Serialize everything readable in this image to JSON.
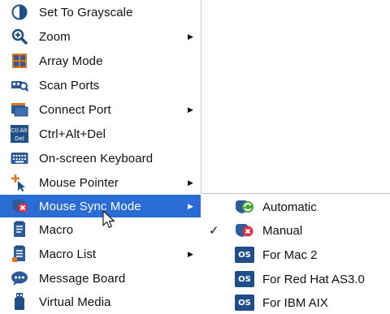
{
  "menu": {
    "items": [
      {
        "label": "Set To Grayscale",
        "icon": "grayscale-icon",
        "has_submenu": false
      },
      {
        "label": "Zoom",
        "icon": "zoom-icon",
        "has_submenu": true
      },
      {
        "label": "Array Mode",
        "icon": "array-mode-icon",
        "has_submenu": false
      },
      {
        "label": "Scan Ports",
        "icon": "scan-ports-icon",
        "has_submenu": false
      },
      {
        "label": "Connect Port",
        "icon": "connect-port-icon",
        "has_submenu": true
      },
      {
        "label": "Ctrl+Alt+Del",
        "icon": "ctrl-alt-del-icon",
        "has_submenu": false
      },
      {
        "label": "On-screen Keyboard",
        "icon": "keyboard-icon",
        "has_submenu": false
      },
      {
        "label": "Mouse Pointer",
        "icon": "mouse-pointer-icon",
        "has_submenu": true
      },
      {
        "label": "Mouse Sync Mode",
        "icon": "mouse-sync-icon",
        "has_submenu": true,
        "active": true
      },
      {
        "label": "Macro",
        "icon": "macro-icon",
        "has_submenu": false
      },
      {
        "label": "Macro List",
        "icon": "macro-list-icon",
        "has_submenu": true
      },
      {
        "label": "Message Board",
        "icon": "message-board-icon",
        "has_submenu": false
      },
      {
        "label": "Virtual Media",
        "icon": "virtual-media-icon",
        "has_submenu": false
      }
    ]
  },
  "submenu": {
    "items": [
      {
        "label": "Automatic",
        "icon": "automatic-sync-icon",
        "checked": false
      },
      {
        "label": "Manual",
        "icon": "manual-sync-icon",
        "checked": true
      },
      {
        "label": "For Mac 2",
        "icon": "os-icon",
        "badge": "OS",
        "checked": false
      },
      {
        "label": "For Red Hat AS3.0",
        "icon": "os-icon",
        "badge": "OS",
        "checked": false
      },
      {
        "label": "For IBM AIX",
        "icon": "os-icon",
        "badge": "OS",
        "checked": false
      }
    ]
  },
  "glyphs": {
    "arrow": "▶",
    "check": "✓"
  },
  "ctrl_icon": {
    "top_left": "Ctl",
    "top_right": "Alt",
    "bottom": "Del"
  },
  "colors": {
    "highlight": "#2a6cd6",
    "os_badge": "#1f4f8a",
    "accent_orange": "#e8731d",
    "accent_red": "#d8324a",
    "accent_green": "#4aa832"
  }
}
